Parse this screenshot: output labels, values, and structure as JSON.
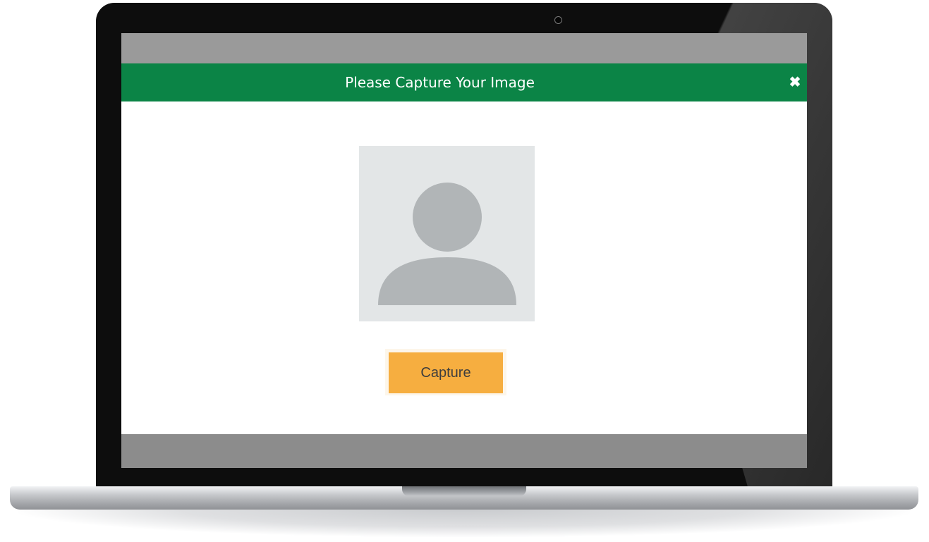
{
  "modal": {
    "title": "Please Capture Your Image",
    "close_label": "✖"
  },
  "capture": {
    "label": "Capture"
  },
  "colors": {
    "header_bg": "#0b8446",
    "button_bg": "#f6ae40",
    "placeholder_bg": "#e3e6e7",
    "avatar_fill": "#b1b5b7"
  },
  "icons": {
    "avatar": "user-placeholder-icon",
    "close": "close-icon",
    "camera": "webcam-icon"
  }
}
